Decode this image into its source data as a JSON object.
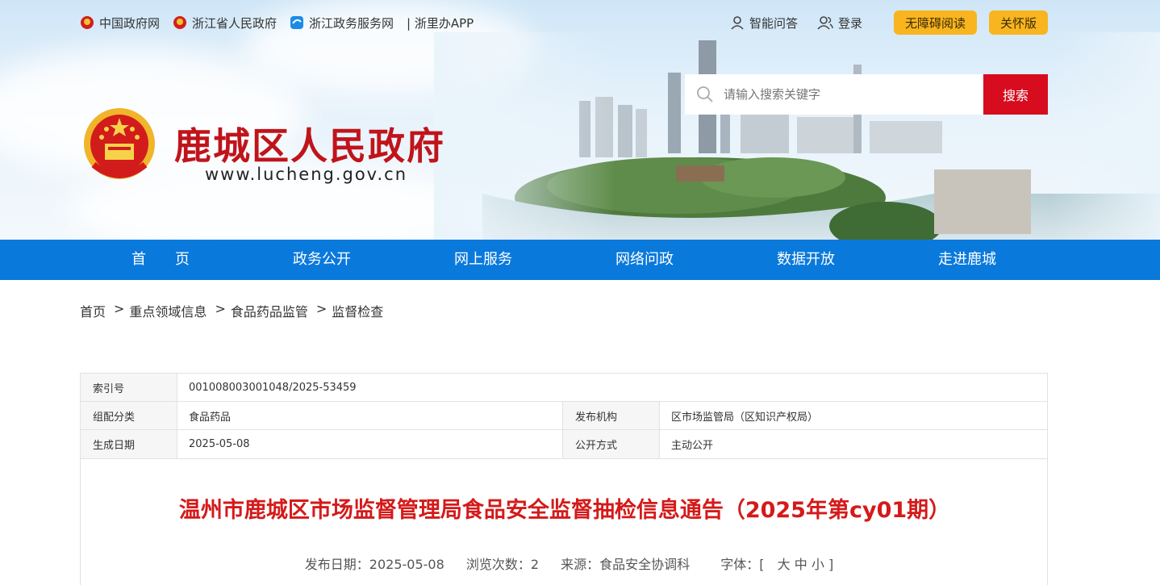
{
  "topbar": {
    "links": [
      {
        "label": "中国政府网",
        "icon": "national-emblem-icon"
      },
      {
        "label": "浙江省人民政府",
        "icon": "national-emblem-icon"
      },
      {
        "label": "浙江政务服务网",
        "icon": "zj-service-icon"
      },
      {
        "label": "| 浙里办APP",
        "icon": ""
      }
    ],
    "qa_label": "智能问答",
    "login_label": "登录",
    "accessible_label": "无障碍阅读",
    "care_label": "关怀版"
  },
  "header": {
    "site_title": "鹿城区人民政府",
    "site_url": "www.lucheng.gov.cn",
    "search_placeholder": "请输入搜索关键字",
    "search_button": "搜索"
  },
  "nav": [
    "首　　页",
    "政务公开",
    "网上服务",
    "网络问政",
    "数据开放",
    "走进鹿城"
  ],
  "breadcrumb": [
    "首页",
    "重点领域信息",
    "食品药品监管",
    "监督检查"
  ],
  "info": {
    "index_label": "索引号",
    "index_value": "001008003001048/2025-53459",
    "category_label": "组配分类",
    "category_value": "食品药品",
    "publisher_label": "发布机构",
    "publisher_value": "区市场监管局（区知识产权局）",
    "date_label": "生成日期",
    "date_value": "2025-05-08",
    "mode_label": "公开方式",
    "mode_value": "主动公开"
  },
  "article": {
    "title": "温州市鹿城区市场监督管理局食品安全监督抽检信息通告（2025年第cy01期）",
    "publish_date": "发布日期：2025-05-08",
    "views": "浏览次数：2",
    "source": "来源：食品安全协调科",
    "font_label": "字体：[",
    "font_large": "大",
    "font_medium": "中",
    "font_small": "小",
    "font_end": "]"
  },
  "colors": {
    "brand_red": "#c0141a",
    "nav_blue": "#0a79dc",
    "accent_yellow": "#f8b520",
    "search_red": "#d70c1f"
  }
}
